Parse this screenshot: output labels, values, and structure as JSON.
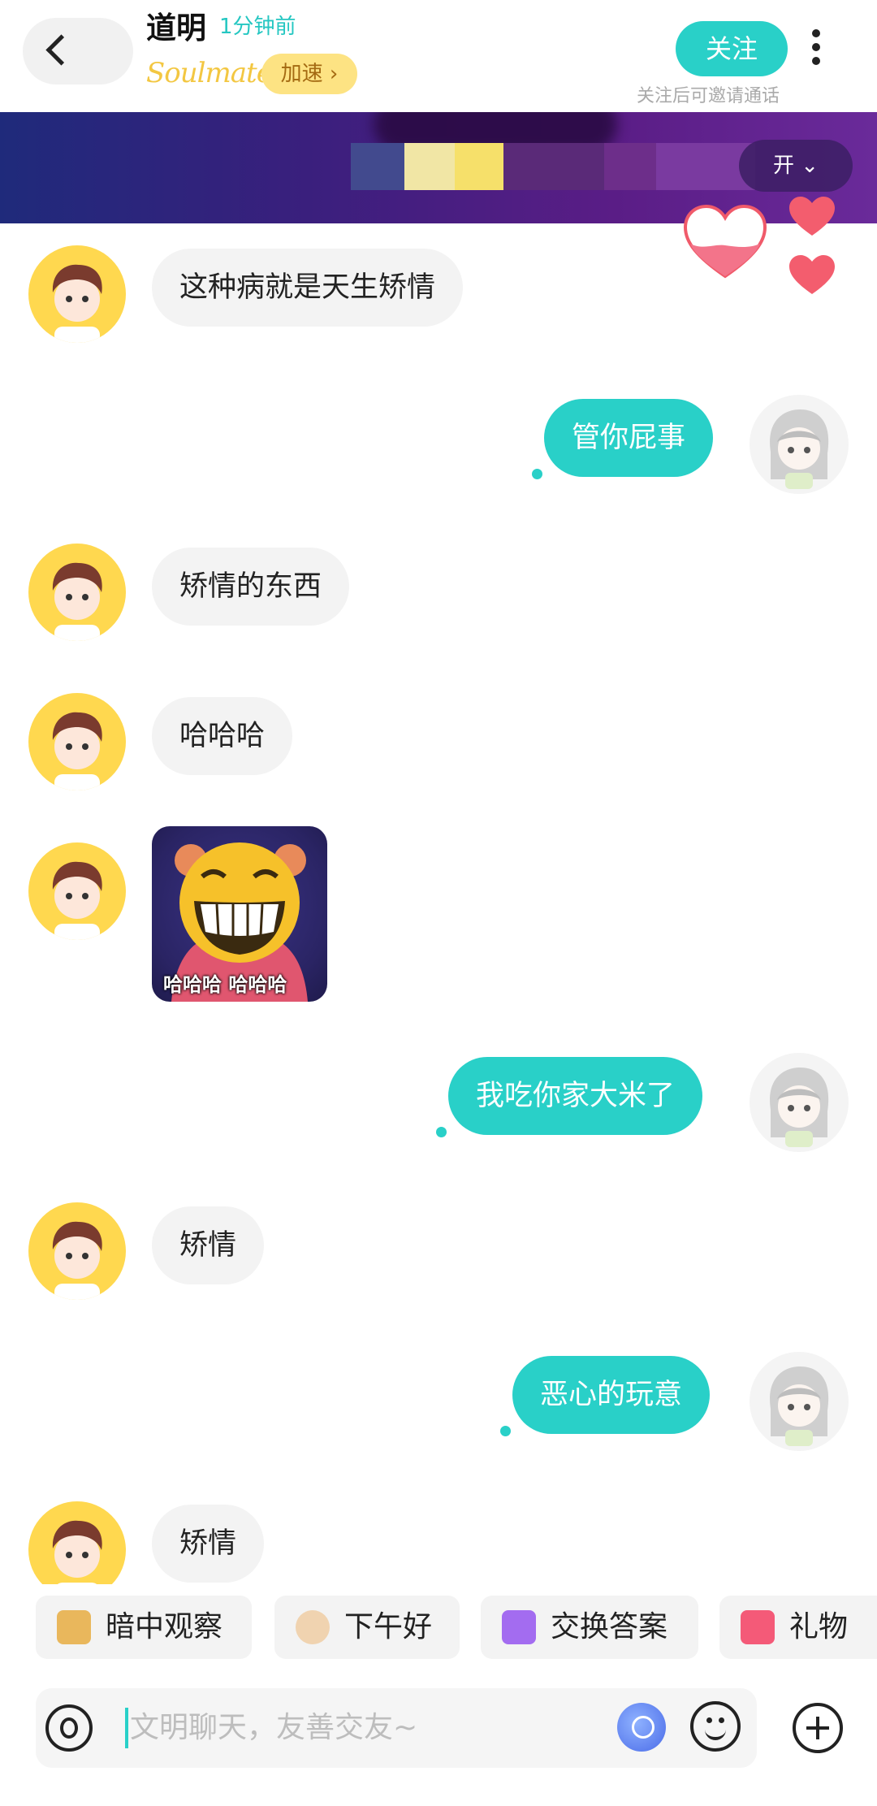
{
  "header": {
    "title": "道明",
    "online_status": "1分钟前",
    "brand": "Soulmate",
    "speed_label": "加速 ›",
    "follow_label": "关注",
    "follow_hint": "关注后可邀请通话"
  },
  "banner": {
    "pill_label": "开 ⌄"
  },
  "messages": [
    {
      "side": "in",
      "text": "这种病就是天生矫情"
    },
    {
      "side": "out",
      "text": "管你屁事"
    },
    {
      "side": "in",
      "text": "矫情的东西"
    },
    {
      "side": "in",
      "text": "哈哈哈"
    },
    {
      "side": "in",
      "type": "sticker",
      "text": "哈哈哈 哈哈哈"
    },
    {
      "side": "out",
      "text": "我吃你家大米了"
    },
    {
      "side": "in",
      "text": "矫情"
    },
    {
      "side": "out",
      "text": "恶心的玩意"
    },
    {
      "side": "in",
      "text": "矫情"
    }
  ],
  "quick_actions": [
    {
      "label": "暗中观察",
      "icon": "doge-peek-icon"
    },
    {
      "label": "下午好",
      "icon": "coffee-icon"
    },
    {
      "label": "交换答案",
      "icon": "exchange-icon"
    },
    {
      "label": "礼物",
      "icon": "gift-icon"
    }
  ],
  "input": {
    "placeholder": "文明聊天，友善交友~"
  },
  "colors": {
    "accent": "#29d0c8",
    "avatar_bg": "#ffd84f",
    "speed_bg": "#fde383"
  }
}
